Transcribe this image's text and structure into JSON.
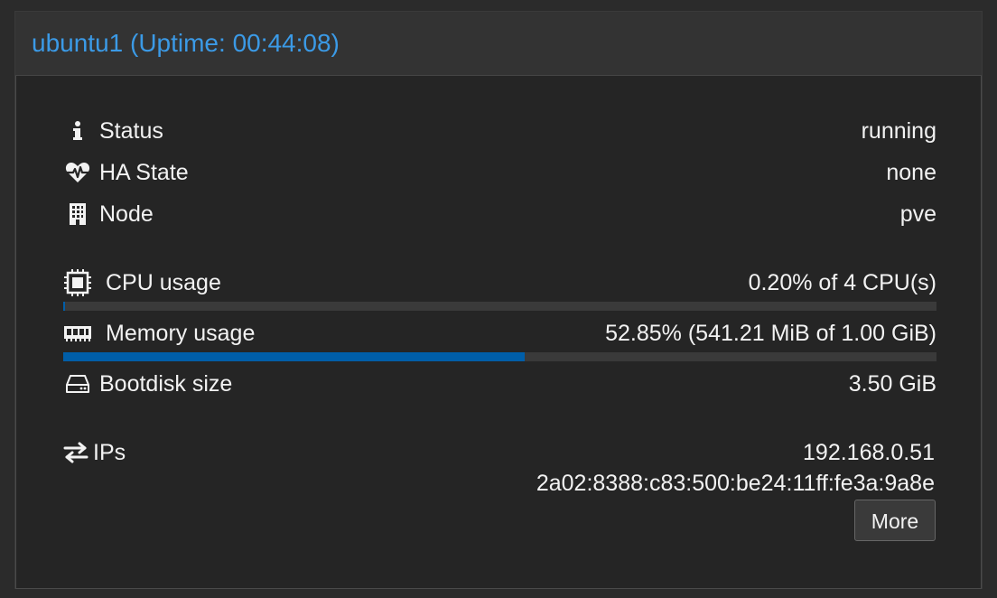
{
  "header": {
    "title": "ubuntu1 (Uptime: 00:44:08)",
    "title_color": "#3b9ae6"
  },
  "summary": {
    "status": {
      "icon": "info-icon",
      "label": "Status",
      "value": "running"
    },
    "ha_state": {
      "icon": "heartbeat-icon",
      "label": "HA State",
      "value": "none"
    },
    "node": {
      "icon": "building-icon",
      "label": "Node",
      "value": "pve"
    },
    "cpu": {
      "icon": "cpu-chip-icon",
      "label": "CPU usage",
      "value": "0.20% of 4 CPU(s)",
      "fraction": 0.002
    },
    "memory": {
      "icon": "memory-icon",
      "label": "Memory usage",
      "value": "52.85% (541.21 MiB of 1.00 GiB)",
      "fraction": 0.5285
    },
    "bootdisk": {
      "icon": "hdd-icon",
      "label": "Bootdisk size",
      "value": "3.50 GiB"
    },
    "ips": {
      "icon": "exchange-icon",
      "label": "IPs",
      "values": [
        "192.168.0.51",
        "2a02:8388:c83:500:be24:11ff:fe3a:9a8e"
      ],
      "more_label": "More"
    }
  },
  "colors": {
    "bar_fill": "#005ea8",
    "bar_track": "#3a3a3a"
  }
}
